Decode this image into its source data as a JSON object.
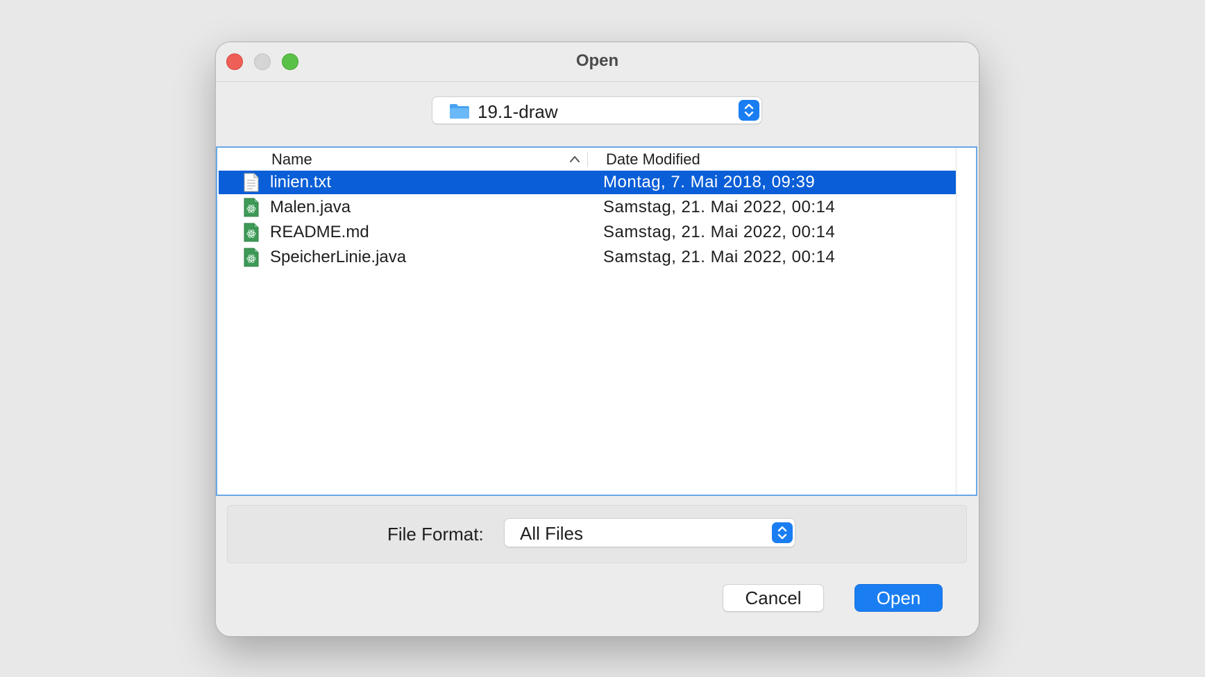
{
  "window": {
    "title": "Open"
  },
  "location": {
    "folder_name": "19.1-draw",
    "icon": "folder-icon"
  },
  "file_list": {
    "columns": [
      "Name",
      "Date Modified"
    ],
    "sort_column": "Name",
    "sort_direction": "ascending",
    "rows": [
      {
        "name": "linien.txt",
        "date": "Montag, 7. Mai 2018, 09:39",
        "icon": "text-file-icon",
        "selected": true
      },
      {
        "name": "Malen.java",
        "date": "Samstag, 21. Mai 2022, 00:14",
        "icon": "java-file-icon",
        "selected": false
      },
      {
        "name": "README.md",
        "date": "Samstag, 21. Mai 2022, 00:14",
        "icon": "java-file-icon",
        "selected": false
      },
      {
        "name": "SpeicherLinie.java",
        "date": "Samstag, 21. Mai 2022, 00:14",
        "icon": "java-file-icon",
        "selected": false
      }
    ]
  },
  "format": {
    "label": "File Format:",
    "value": "All Files"
  },
  "buttons": {
    "cancel": "Cancel",
    "open": "Open"
  },
  "colors": {
    "accent": "#1a7ef2",
    "selection": "#0a5ed7",
    "close": "#ee5f57",
    "maximize": "#5ac148"
  }
}
